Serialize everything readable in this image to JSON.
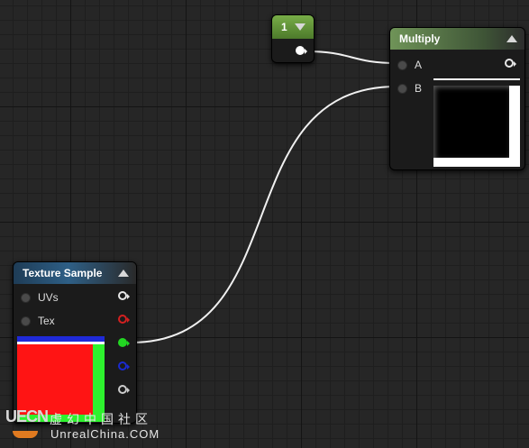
{
  "constant_node": {
    "value": "1"
  },
  "multiply_node": {
    "title": "Multiply",
    "pin_a": "A",
    "pin_b": "B"
  },
  "texture_node": {
    "title": "Texture Sample",
    "pin_uvs": "UVs",
    "pin_tex": "Tex"
  },
  "watermark": {
    "logo": "UECN",
    "chinese": "虚幻中国社区",
    "site": "UnrealChina.COM"
  },
  "colors": {
    "constant_header": "#5a8a32",
    "multiply_header": "#5d7a4a",
    "texture_header": "#2a4a66",
    "wire": "#f0f0f0",
    "pin_rgb": "#e8e8e8",
    "pin_r": "#d42020",
    "pin_g": "#22d622",
    "pin_b": "#1a2ad0",
    "pin_a": "#cccccc"
  }
}
